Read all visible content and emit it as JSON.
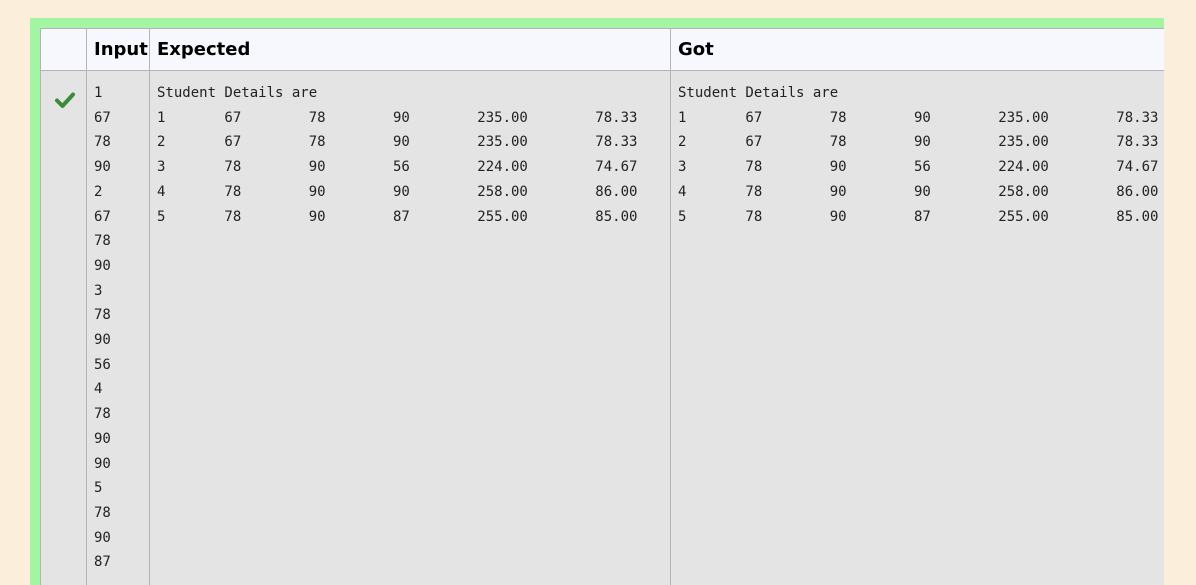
{
  "headers": {
    "status": "",
    "input": "Input",
    "expected": "Expected",
    "got": "Got"
  },
  "row": {
    "status_icon": "check-icon",
    "status_color": "#2e7d32",
    "input_lines": [
      "1",
      "67",
      "78",
      "90",
      "2",
      "67",
      "78",
      "90",
      "3",
      "78",
      "90",
      "56",
      "4",
      "78",
      "90",
      "90",
      "5",
      "78",
      "90",
      "87"
    ],
    "expected_lines": [
      "Student Details are",
      "1       67        78        90        235.00        78.33",
      "2       67        78        90        235.00        78.33",
      "3       78        90        56        224.00        74.67",
      "4       78        90        90        258.00        86.00",
      "5       78        90        87        255.00        85.00"
    ],
    "got_lines": [
      "Student Details are",
      "1       67        78        90        235.00        78.33",
      "2       67        78        90        235.00        78.33",
      "3       78        90        56        224.00        74.67",
      "4       78        90        90        258.00        86.00",
      "5       78        90        87        255.00        85.00"
    ]
  },
  "colors": {
    "frame_green": "#a3f5a3",
    "page_background": "#fbefdc",
    "header_background": "#f7f8fd",
    "cell_background": "#e4e4e4"
  }
}
